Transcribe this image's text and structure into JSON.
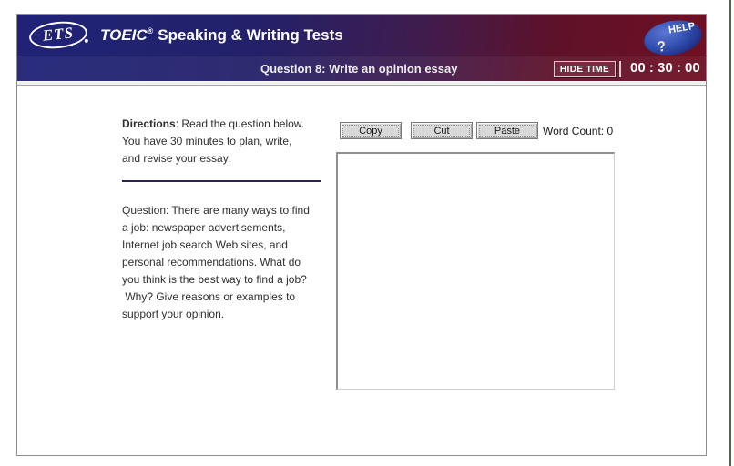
{
  "header": {
    "logo_text": "ETS",
    "title_brand": "TOEIC",
    "title_reg": "®",
    "title_rest": "Speaking & Writing Tests",
    "question_label": "Question 8: Write an opinion essay",
    "hide_time_label": "HIDE TIME",
    "timer": "00 : 30 : 00",
    "help_label": "HELP",
    "help_qmark": "?",
    "colors": {
      "header_left_navy": "#1f2277",
      "header_right_maroon": "#6f1022",
      "help_button_blue": "#3350b0",
      "screen_edge_green": "#55644d",
      "directions_divider": "#2e2250"
    }
  },
  "directions": {
    "bold_label": "Directions",
    "line1_rest": ": Read the question below.",
    "line2": "You have 30 minutes to plan, write,",
    "line3": "and revise your essay."
  },
  "question": {
    "lines": [
      "Question: There are many ways to find",
      "a job: newspaper advertisements,",
      "Internet job search Web sites, and",
      "personal recommendations. What do",
      "you think is the best way to find a job?",
      " Why? Give reasons or examples to",
      "support your opinion."
    ]
  },
  "toolbar": {
    "copy_label": "Copy",
    "cut_label": "Cut",
    "paste_label": "Paste",
    "word_count": "Word Count: 0"
  },
  "editor": {
    "value": ""
  }
}
